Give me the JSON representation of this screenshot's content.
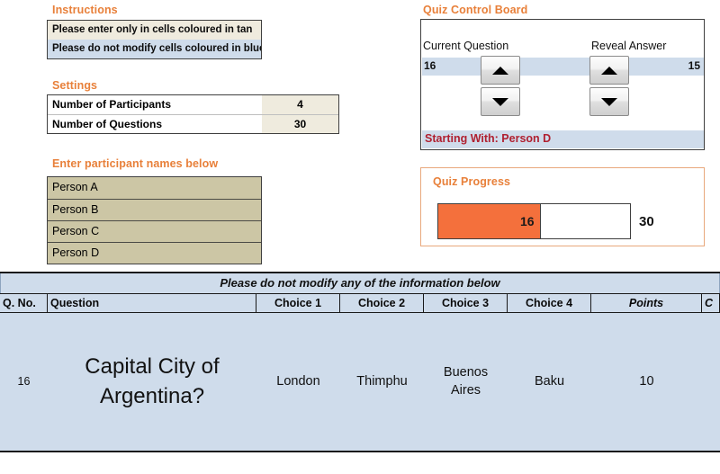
{
  "instructions": {
    "title": "Instructions",
    "lines": [
      "Please enter only in cells coloured in tan",
      "Please do not modify cells coloured in blue"
    ]
  },
  "settings": {
    "title": "Settings",
    "rows": [
      {
        "label": "Number of Participants",
        "value": "4"
      },
      {
        "label": "Number of Questions",
        "value": "30"
      }
    ]
  },
  "participants": {
    "title": "Enter participant names below",
    "names": [
      "Person A",
      "Person B",
      "Person C",
      "Person D"
    ]
  },
  "control_board": {
    "title": "Quiz Control Board",
    "current_question_label": "Current Question",
    "current_question_value": "16",
    "reveal_answer_label": "Reveal Answer",
    "reveal_answer_value": "15",
    "spinner_up_icon": "triangle-up-icon",
    "spinner_down_icon": "triangle-down-icon",
    "starting_with": "Starting With: Person D"
  },
  "progress": {
    "title": "Quiz Progress",
    "current": "16",
    "total": "30",
    "fill_percent": 53.3,
    "fill_color": "#F4703C"
  },
  "table": {
    "banner": "Please do not modify any of the information below",
    "headers": {
      "qno": "Q. No.",
      "question": "Question",
      "choice1": "Choice 1",
      "choice2": "Choice 2",
      "choice3": "Choice 3",
      "choice4": "Choice 4",
      "points": "Points",
      "last": "C"
    },
    "row": {
      "qno": "16",
      "question": "Capital City of Argentina?",
      "choice1": "London",
      "choice2": "Thimphu",
      "choice3": "Buenos Aires",
      "choice4": "Baku",
      "points": "10",
      "last": ""
    }
  },
  "colors": {
    "accent_orange": "#E8803A",
    "tan": "#CCC6A5",
    "cream": "#EFEBDE",
    "light_blue": "#CFDCEB",
    "progress_orange": "#F4703C",
    "starting_red": "#B02030"
  }
}
